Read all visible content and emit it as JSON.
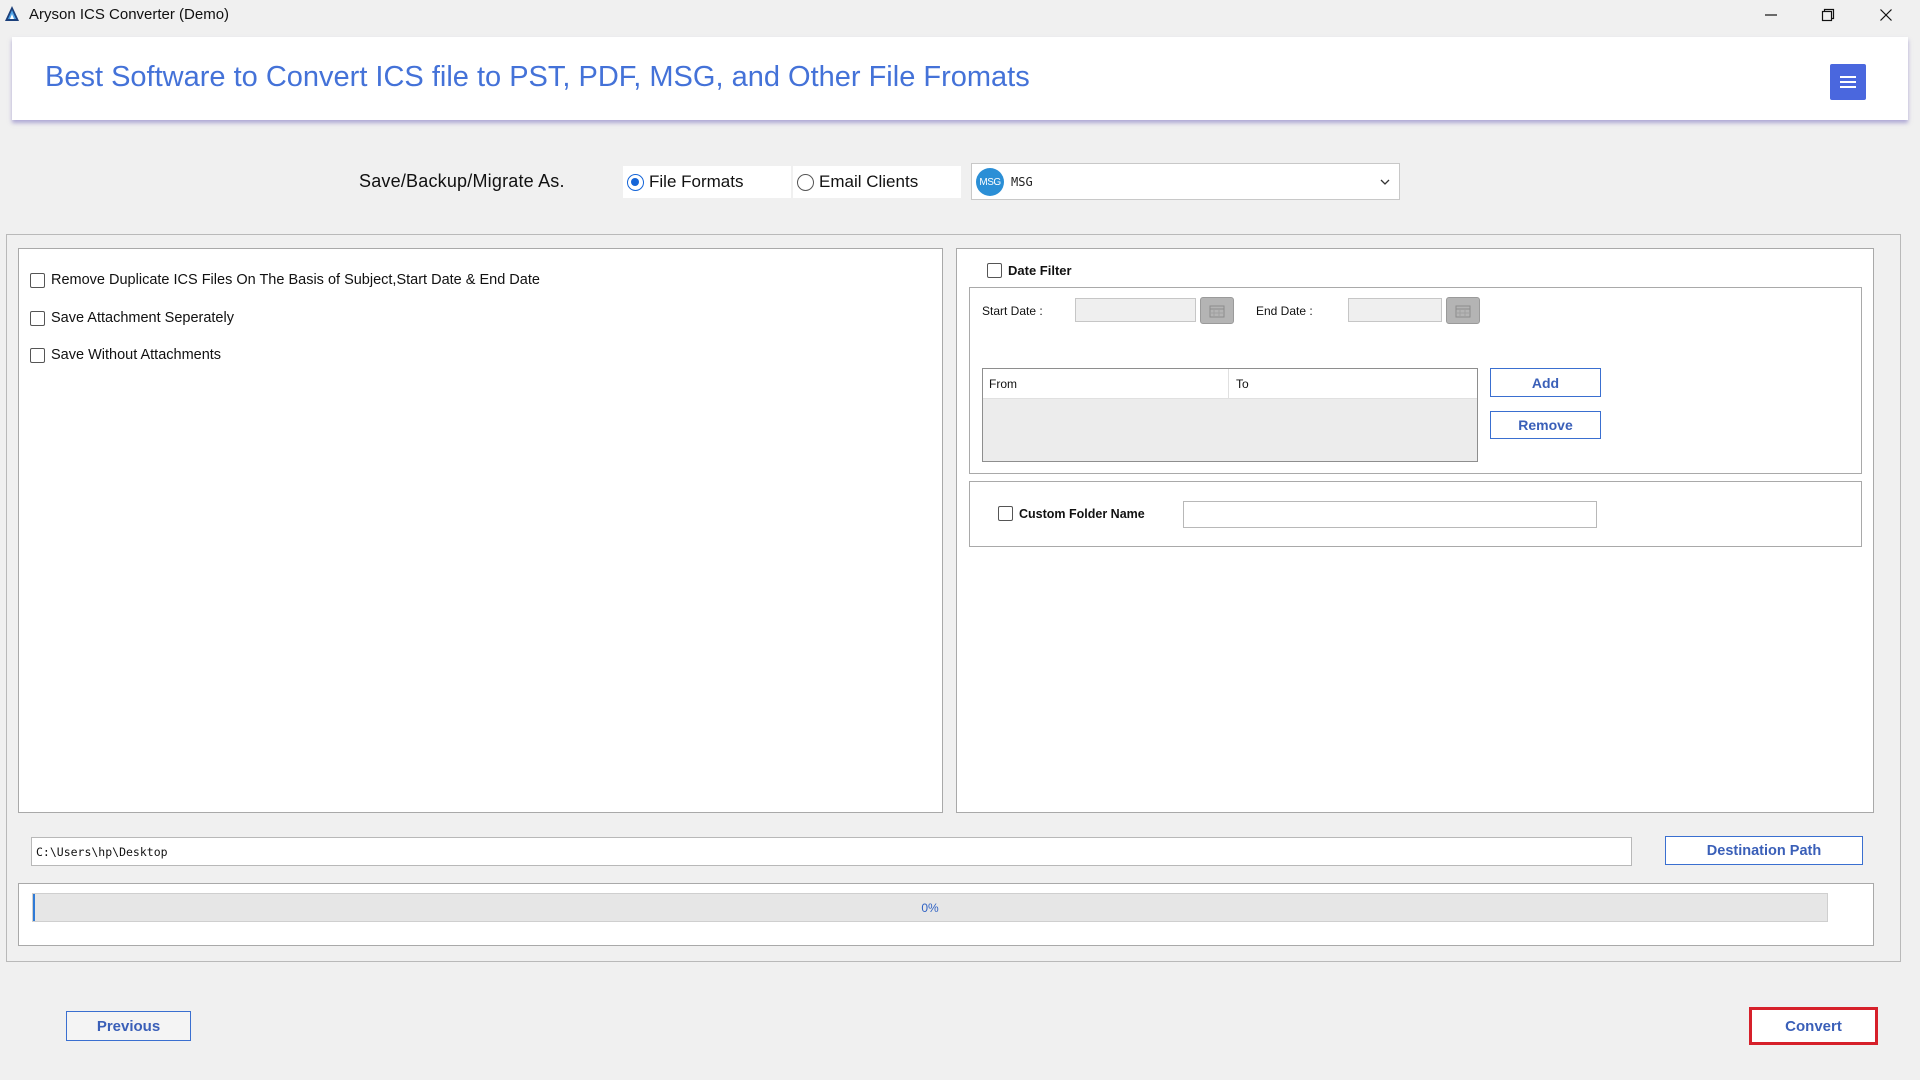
{
  "window": {
    "title": "Aryson ICS Converter (Demo)"
  },
  "header": {
    "heading": "Best Software to Convert ICS file to PST, PDF, MSG, and Other File Fromats"
  },
  "format": {
    "label": "Save/Backup/Migrate As.",
    "options": [
      "File Formats",
      "Email Clients"
    ],
    "selected_option": "File Formats",
    "dropdown_badge": "MSG",
    "dropdown_value": "MSG"
  },
  "options": {
    "items": [
      {
        "label": "Remove Duplicate ICS Files On The Basis of Subject,Start Date & End Date",
        "checked": false
      },
      {
        "label": "Save Attachment Seperately",
        "checked": false
      },
      {
        "label": "Save Without Attachments",
        "checked": false
      }
    ]
  },
  "date_filter": {
    "label": "Date Filter",
    "checked": false,
    "start_label": "Start Date :",
    "end_label": "End Date :",
    "start_value": "",
    "end_value": "",
    "columns": [
      "From",
      "To"
    ],
    "add_label": "Add",
    "remove_label": "Remove"
  },
  "custom_folder": {
    "label": "Custom Folder Name",
    "checked": false,
    "value": ""
  },
  "destination": {
    "path": "C:\\Users\\hp\\Desktop",
    "button_label": "Destination Path"
  },
  "progress": {
    "percent": 0,
    "text": "0%"
  },
  "footer": {
    "previous_label": "Previous",
    "convert_label": "Convert"
  },
  "colors": {
    "accent": "#4472d8",
    "menu_button": "#4a67de",
    "highlight": "#d6202a"
  }
}
